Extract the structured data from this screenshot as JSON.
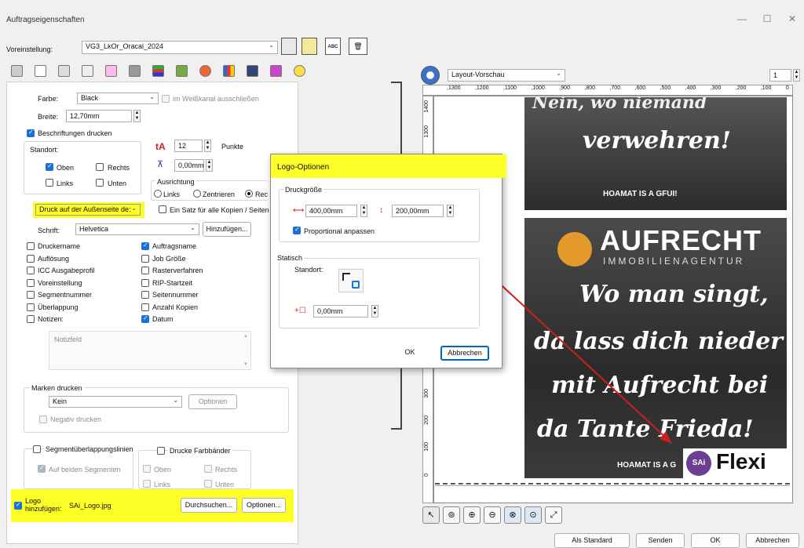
{
  "window": {
    "title": "Auftragseigenschaften",
    "minimize": "—",
    "maximize": "☐",
    "close": "✕"
  },
  "preset": {
    "label": "Voreinstellung:",
    "value": "VG3_LkOr_Oracal_2024"
  },
  "toolbar_icons": [
    "printer-icon",
    "document-icon",
    "page-icon",
    "layout-icon",
    "grid-icon",
    "frame-icon",
    "color-bars-icon",
    "stack-icon",
    "palette-icon",
    "chart-icon",
    "shape-icon",
    "pen-icon",
    "wand-icon"
  ],
  "form": {
    "color_label": "Farbe:",
    "color_value": "Black",
    "exclude_white_label": "im Weißkanal ausschließen",
    "width_label": "Breite:",
    "width_value": "12,70mm",
    "print_labels_label": "Beschriftungen drucken",
    "location_label": "Standort:",
    "top": "Oben",
    "right": "Rechts",
    "left": "Links",
    "bottom": "Unten",
    "font_size_value": "12",
    "font_size_unit": "Punkte",
    "offset_value": "0,00mm",
    "alignment_label": "Ausrichtung",
    "align_left": "Links",
    "align_center": "Zentrieren",
    "align_right": "Rec",
    "print_outside_value": "Druck auf der Außenseite de:",
    "one_set_label": "Ein Satz für alle Kopien / Seiten",
    "font_label": "Schrift:",
    "font_value": "Helvetica",
    "add_button": "Hinzufügen...",
    "fields_left": [
      "Druckername",
      "Auflösung",
      "ICC Ausgabeprofil",
      "Voreinstellung",
      "Segmentnummer",
      "Überlappung",
      "Notizen:"
    ],
    "fields_right": [
      "Auftragsname",
      "Job Größe",
      "Rasterverfahren",
      "RIP-Startzeit",
      "Seitennummer",
      "Anzahl Kopien",
      "Datum"
    ],
    "notes_placeholder": "Notizfeld",
    "marks_label": "Marken drucken",
    "marks_value": "Kein",
    "marks_options": "Optionen",
    "negative_label": "Negativ drucken",
    "segment_lines_label": "Segmentüberlappungslinien",
    "both_segments_label": "Auf beiden Segmenten",
    "color_bands_label": "Drucke Farbbänder",
    "cb_top": "Oben",
    "cb_right": "Rechts",
    "cb_left": "Links",
    "cb_bottom": "Unten",
    "logo_label_1": "Logo",
    "logo_label_2": "hinzufügen:",
    "logo_file": "SAi_Logo.jpg",
    "browse_button": "Durchsuchen...",
    "options_button": "Optionen..."
  },
  "preview": {
    "mode_value": "Layout-Vorschau",
    "page_value": "1",
    "ruler_ticks": [
      ",1300",
      ",1200",
      ",1100",
      ",1000",
      ",900",
      ",800",
      ",700",
      ",600",
      ",500",
      ",400",
      ",300",
      ",200",
      ",100",
      "0"
    ],
    "ruler_v_ticks": [
      "1400",
      "1300",
      "300",
      "200",
      "100",
      "0"
    ],
    "top_tile_text_1": "Nein, wo niemand",
    "top_tile_text_2": "verwehren!",
    "top_tile_footer": "HOAMAT IS A GFUI!",
    "brand_big": "AUFRECHT",
    "brand_small": "IMMOBILIENAGENTUR",
    "script_lines": [
      "Wo man singt,",
      "da lass dich nieder",
      "mit Aufrecht bei",
      "da Tante Frieda!"
    ],
    "bottom_footer": "HOAMAT IS A G",
    "logo_badge": "SAi",
    "logo_text": "Flexi"
  },
  "logo_dialog": {
    "title": "Logo-Optionen",
    "size_label": "Druckgröße",
    "width_value": "400,00mm",
    "height_value": "200,00mm",
    "proportional_label": "Proportional anpassen",
    "static_label": "Statisch",
    "location_label": "Standort:",
    "offset_value": "0,00mm",
    "ok": "OK",
    "cancel": "Abbrechen"
  },
  "footer": {
    "default_button": "Als Standard",
    "send_button": "Senden",
    "ok_button": "OK",
    "cancel_button": "Abbrechen"
  },
  "colors": {
    "highlight": "#ffff28",
    "accent": "#1a73d4",
    "arrow": "#cc1f1f"
  }
}
